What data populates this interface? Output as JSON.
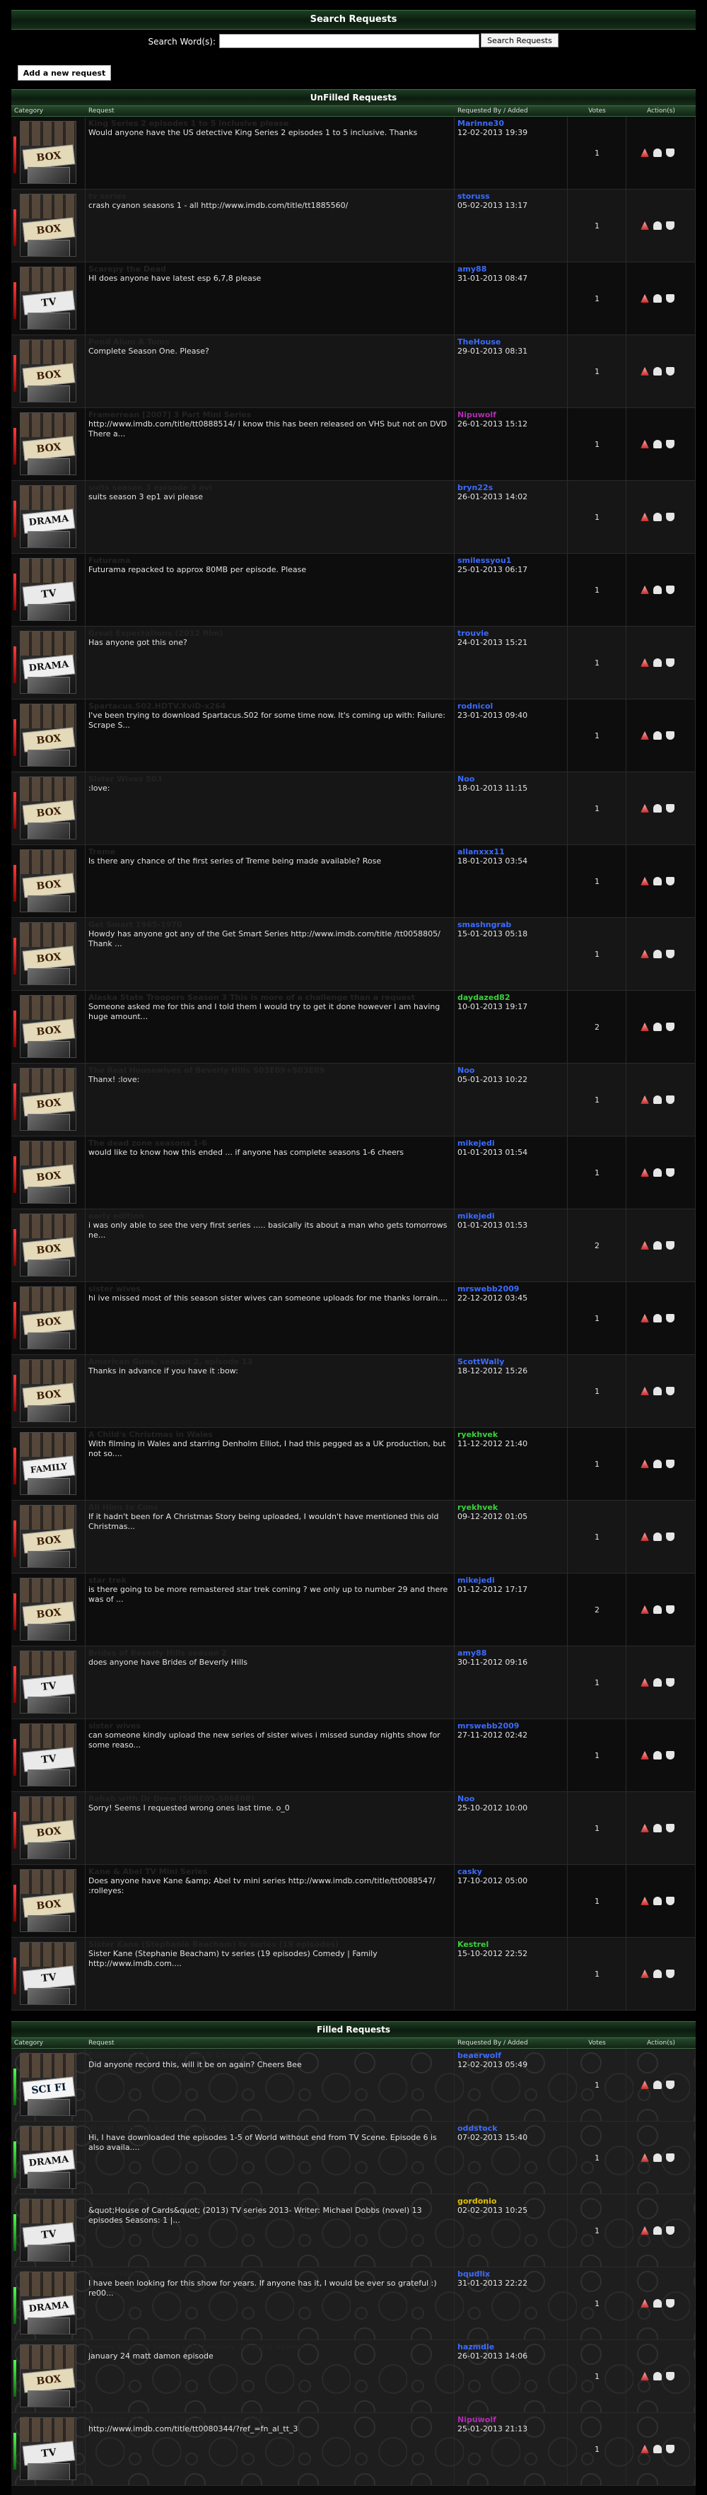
{
  "search": {
    "title": "Search Requests",
    "label": "Search Word(s):",
    "placeholder": "",
    "button": "Search Requests",
    "add_button": "Add a new request"
  },
  "columns": {
    "category": "Category",
    "request": "Request",
    "by": "Requested By / Added",
    "votes": "Votes",
    "actions": "Action(s)"
  },
  "unfilled": {
    "title": "UnFilled Requests",
    "rows": [
      {
        "cat": "BOX SETS",
        "title": "King Series 2 episodes 1 to 5 inclusive please",
        "desc": "Would anyone have the US detective King Series 2 episodes 1 to 5 inclusive. Thanks",
        "user": "Marinne30",
        "user_color": "#3a6bff",
        "date": "12-02-2013 19:39",
        "votes": "1"
      },
      {
        "cat": "BOX SETS",
        "title": "tv series",
        "desc": "crash cyanon seasons 1 - all http://www.imdb.com/title/tt1885560/",
        "user": "storuss",
        "user_color": "#3a6bff",
        "date": "05-02-2013 13:17",
        "votes": "1"
      },
      {
        "cat": "TV SERIES",
        "title": "Scarepy the Dead",
        "desc": "HI does anyone have latest esp 6,7,8 please",
        "user": "amy88",
        "user_color": "#3a6bff",
        "date": "31-01-2013 08:47",
        "votes": "1"
      },
      {
        "cat": "BOX SETS",
        "title": "Pond Alum A Toms",
        "desc": "Complete Season One. Please?",
        "user": "TheHouse",
        "user_color": "#3a6bff",
        "date": "29-01-2013 08:31",
        "votes": "1"
      },
      {
        "cat": "BOX SETS",
        "title": "Framerrean [2007] 3 Part Mini Series",
        "desc": "http://www.imdb.com/title/tt0888514/ I know this has been released on VHS but not on DVD There a...",
        "user": "Nipuwolf",
        "user_color": "#b22bb2",
        "date": "26-01-2013 15:12",
        "votes": "1"
      },
      {
        "cat": "DRAMA",
        "title": "suits season 3 episode 3 avi",
        "desc": "suits season 3 ep1 avi please",
        "user": "bryn22s",
        "user_color": "#3a6bff",
        "date": "26-01-2013 14:02",
        "votes": "1"
      },
      {
        "cat": "TV SERIES",
        "title": "Futurama",
        "desc": "Futurama repacked to approx 80MB per episode. Please",
        "user": "smilessyou1",
        "user_color": "#3a6bff",
        "date": "25-01-2013 06:17",
        "votes": "1"
      },
      {
        "cat": "DRAMA",
        "title": "Great Expectations (2012 film)",
        "desc": "Has anyone got this one?",
        "user": "trouvie",
        "user_color": "#3a6bff",
        "date": "24-01-2013 15:21",
        "votes": "1"
      },
      {
        "cat": "BOX SETS",
        "title": "Spartacus.S02.HDTV.XviD-x264",
        "desc": "I've been trying to download Spartacus.S02 for some time now. It's coming up with: Failure: Scrape S...",
        "user": "rodnicol",
        "user_color": "#3a6bff",
        "date": "23-01-2013 09:40",
        "votes": "1"
      },
      {
        "cat": "BOX SETS",
        "title": "Sister Wives S03",
        "desc": ":love:",
        "user": "Noo",
        "user_color": "#3a6bff",
        "date": "18-01-2013 11:15",
        "votes": "1"
      },
      {
        "cat": "BOX SETS",
        "title": "Treme",
        "desc": "Is there any chance of the first series of Treme being made available? Rose",
        "user": "allanxxx11",
        "user_color": "#3a6bff",
        "date": "18-01-2013 03:54",
        "votes": "1"
      },
      {
        "cat": "BOX SETS",
        "title": "Get Smart 1965-1970",
        "desc": "Howdy has anyone got any of the Get Smart Series http://www.imdb.com/title /tt0058805/ Thank ...",
        "user": "smashngrab",
        "user_color": "#3a6bff",
        "date": "15-01-2013 05:18",
        "votes": "1"
      },
      {
        "cat": "BOX SETS",
        "title": "Alaska State Troopers Season 3 This is more of a challenge than a request",
        "desc": "Someone asked me for this and I told them I would try to get it done however I am having huge amount...",
        "user": "daydazed82",
        "user_color": "#3ad13a",
        "date": "10-01-2013 19:17",
        "votes": "2"
      },
      {
        "cat": "BOX SETS",
        "title": "The Real Housewives of Beverly Hills S03E09+S03E09",
        "desc": "Thanx! :love:",
        "user": "Noo",
        "user_color": "#3a6bff",
        "date": "05-01-2013 10:22",
        "votes": "1"
      },
      {
        "cat": "BOX SETS",
        "title": "The dead zone seasons 1-6",
        "desc": "would like to know how this ended ... if anyone has complete seasons 1-6 cheers",
        "user": "mikejedi",
        "user_color": "#3a6bff",
        "date": "01-01-2013 01:54",
        "votes": "1"
      },
      {
        "cat": "BOX SETS",
        "title": "early edition",
        "desc": "i was only able to see the very first series ..... basically its about a man who gets tomorrows ne...",
        "user": "mikejedi",
        "user_color": "#3a6bff",
        "date": "01-01-2013 01:53",
        "votes": "2"
      },
      {
        "cat": "BOX SETS",
        "title": "sister wives",
        "desc": "hi ive missed most of this season sister wives can someone uploads for me thanks lorrain....",
        "user": "mrswebb2009",
        "user_color": "#3a6bff",
        "date": "22-12-2012 03:45",
        "votes": "1"
      },
      {
        "cat": "BOX SETS",
        "title": "American Guns, season 2, episode 13",
        "desc": "Thanks in advance if you have it :bow:",
        "user": "ScottWally",
        "user_color": "#3a6bff",
        "date": "18-12-2012 15:26",
        "votes": "1"
      },
      {
        "cat": "FAMILY",
        "title": "A Child's Christmas in Wales",
        "desc": "With filming in Wales and starring Denholm Elliot, I had this pegged as a UK production, but not so....",
        "user": "ryekhvek",
        "user_color": "#3ad13a",
        "date": "11-12-2012 21:40",
        "votes": "1"
      },
      {
        "cat": "BOX SETS",
        "title": "All Hion to Cons",
        "desc": "If it hadn't been for A Christmas Story being uploaded, I wouldn't have mentioned this old Christmas...",
        "user": "ryekhvek",
        "user_color": "#3ad13a",
        "date": "09-12-2012 01:05",
        "votes": "1"
      },
      {
        "cat": "BOX SETS",
        "title": "star trek",
        "desc": "is there going to be more remastered star trek coming ? we only up to number 29 and there was of ...",
        "user": "mikejedi",
        "user_color": "#3a6bff",
        "date": "01-12-2012 17:17",
        "votes": "2"
      },
      {
        "cat": "TV SERIES",
        "title": "Brides of Beverly Hills season 2",
        "desc": "does anyone have Brides of Beverly Hills",
        "user": "amy88",
        "user_color": "#3a6bff",
        "date": "30-11-2012 09:16",
        "votes": "1"
      },
      {
        "cat": "TV SERIES",
        "title": "sister wives",
        "desc": "can someone kindly upload the new series of sister wives i missed sunday nights show for some reaso...",
        "user": "mrswebb2009",
        "user_color": "#3a6bff",
        "date": "27-11-2012 02:42",
        "votes": "1"
      },
      {
        "cat": "BOX SETS",
        "title": "Rehab with Dr Drew (S00E05-S06E08)",
        "desc": "Sorry! Seems I requested wrong ones last time. o_0",
        "user": "Noo",
        "user_color": "#3a6bff",
        "date": "25-10-2012 10:00",
        "votes": "1"
      },
      {
        "cat": "BOX SETS",
        "title": "Kane & Abel TV Mini Series",
        "desc": "Does anyone have Kane &amp; Abel tv mini series http://www.imdb.com/title/tt0088547/ :rolleyes:",
        "user": "casky",
        "user_color": "#3a6bff",
        "date": "17-10-2012 05:00",
        "votes": "1"
      },
      {
        "cat": "TV SERIES",
        "title": "Sister Kane (Stephanie Beacham) tv series (19 episodes)",
        "desc": "Sister Kane (Stephanie Beacham) tv series (19 episodes) Comedy | Family http://www.imdb.com....",
        "user": "Kestrel",
        "user_color": "#3ad13a",
        "date": "15-10-2012 22:52",
        "votes": "1"
      }
    ]
  },
  "filled": {
    "title": "Filled Requests",
    "rows": [
      {
        "cat": "SCI FI",
        "title": "Battlestar Galactica Blood & Chrome",
        "desc": "Did anyone record this, will it be on again? Cheers Bee",
        "user": "beaerwolf",
        "user_color": "#3a6bff",
        "date": "12-02-2013 05:49",
        "votes": "1"
      },
      {
        "cat": "DRAMA",
        "title": "World Without End episodes 5&1",
        "desc": "Hi, I have downloaded the episodes 1-5 of World without end from TV Scene. Episode 6 is also availa....",
        "user": "oddstock",
        "user_color": "#3a6bff",
        "date": "07-02-2013 15:40",
        "votes": "1"
      },
      {
        "cat": "TV SERIES",
        "title": "\"House of Cards\" (2013) TV series 2013-",
        "desc": "&quot;House of Cards&quot; (2013) TV series 2013- Writer: Michael Dobbs (novel) 13 episodes Seasons: 1 |...",
        "user": "gordonio",
        "user_color": "#e0c000",
        "date": "02-02-2013 10:25",
        "votes": "1"
      },
      {
        "cat": "DRAMA",
        "title": "Honey West",
        "desc": "I have been looking for this show for years. If anyone has it, I would be ever so grateful :) re00...",
        "user": "bqudlix",
        "user_color": "#3a6bff",
        "date": "31-01-2013 22:22",
        "votes": "1"
      },
      {
        "cat": "BOX SETS",
        "title": "Jimmy kimmel January 24 January 25 matt damon",
        "desc": "january 24 matt damon episode",
        "user": "hazmdle",
        "user_color": "#3a6bff",
        "date": "26-01-2013 14:06",
        "votes": "1"
      },
      {
        "cat": "TV SERIES",
        "title": "Alcatraz: The Whole Shocking Story 1980",
        "desc": "http://www.imdb.com/title/tt0080344/?ref_=fn_al_tt_3",
        "user": "Nipuwolf",
        "user_color": "#b22bb2",
        "date": "25-01-2013 21:13",
        "votes": "1"
      }
    ]
  }
}
